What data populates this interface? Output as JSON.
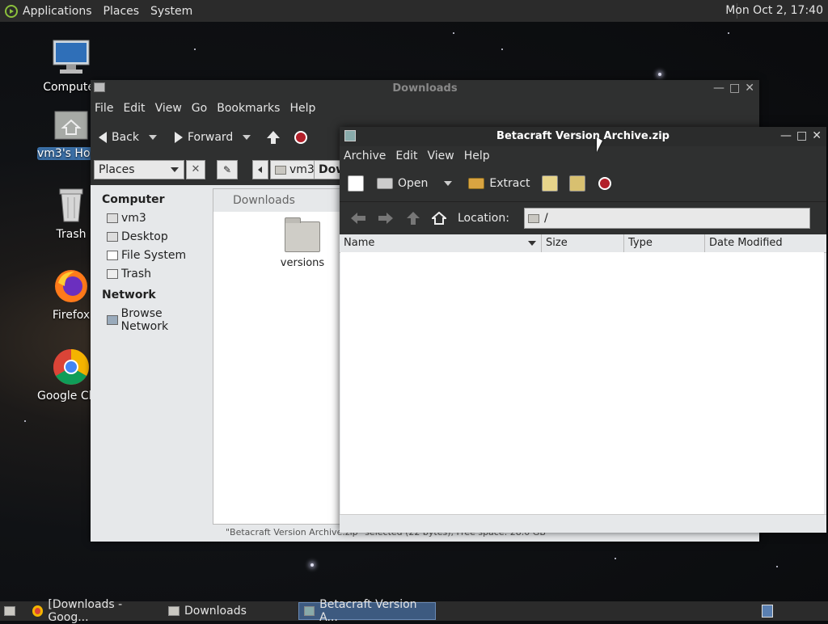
{
  "top_panel": {
    "menus": [
      "Applications",
      "Places",
      "System"
    ],
    "clock": "Mon Oct  2, 17:40"
  },
  "desktop_icons": [
    {
      "label": "Computer",
      "icon": "computer-icon"
    },
    {
      "label": "vm3's Home",
      "icon": "home-folder-icon",
      "selected": true
    },
    {
      "label": "Trash",
      "icon": "trash-icon"
    },
    {
      "label": "Firefox",
      "icon": "firefox-icon"
    },
    {
      "label": "Google Chrome",
      "icon": "chrome-icon"
    }
  ],
  "file_manager": {
    "title": "Downloads",
    "menu": [
      "File",
      "Edit",
      "View",
      "Go",
      "Bookmarks",
      "Help"
    ],
    "toolbar": {
      "back": "Back",
      "forward": "Forward"
    },
    "places_combo": "Places",
    "breadcrumbs": [
      "vm3",
      "Downloads"
    ],
    "sidebar": {
      "computer_header": "Computer",
      "computer_items": [
        "vm3",
        "Desktop",
        "File System",
        "Trash"
      ],
      "network_header": "Network",
      "network_items": [
        "Browse Network"
      ]
    },
    "location_tab": "Downloads",
    "items": [
      {
        "name": "versions",
        "icon": "folder-icon"
      }
    ],
    "status": "\"Betacraft Version Archive.zip\" selected (22 bytes), Free space: 28.0 GB"
  },
  "archive_manager": {
    "title": "Betacraft Version Archive.zip",
    "menu": [
      "Archive",
      "Edit",
      "View",
      "Help"
    ],
    "toolbar": {
      "open": "Open",
      "extract": "Extract"
    },
    "location_label": "Location:",
    "location_value": "/",
    "columns": [
      "Name",
      "Size",
      "Type",
      "Date Modified"
    ]
  },
  "taskbar": {
    "tasks": [
      "[Downloads - Goog...",
      "Downloads",
      "Betacraft Version A..."
    ]
  },
  "colors": {
    "panel": "#2b2b2b",
    "active_task": "#3d5a80",
    "stop_red": "#b2202a"
  }
}
